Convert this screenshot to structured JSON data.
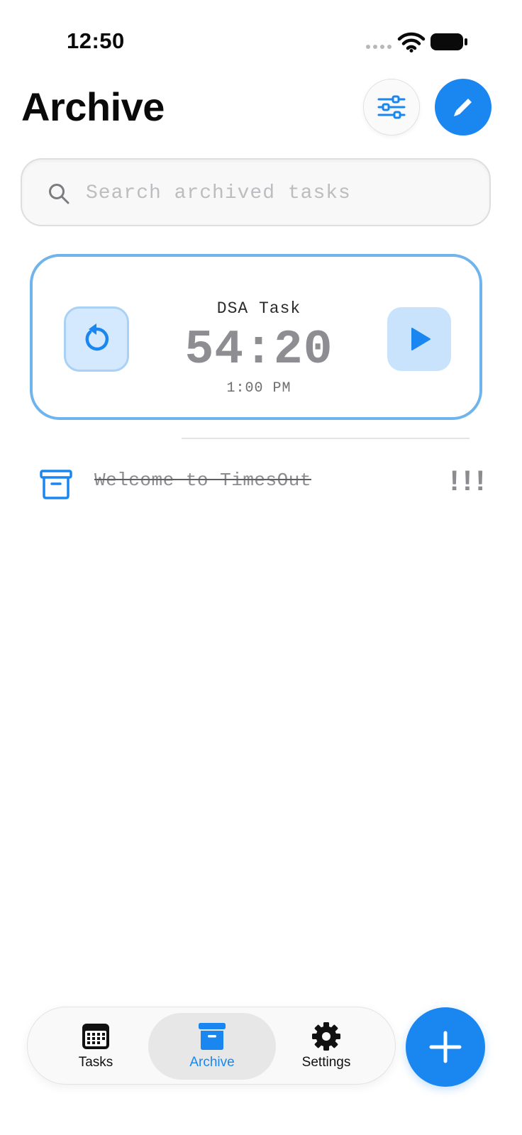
{
  "status_bar": {
    "time": "12:50",
    "icons": [
      "signal-dots-icon",
      "wifi-icon",
      "battery-icon"
    ]
  },
  "header": {
    "title": "Archive",
    "filter_icon": "sliders-icon",
    "edit_icon": "pencil-icon"
  },
  "search": {
    "placeholder": "Search archived tasks",
    "value": ""
  },
  "timer_card": {
    "task_name": "DSA Task",
    "countdown": "54:20",
    "scheduled_time": "1:00 PM",
    "reset_icon": "reset-icon",
    "play_icon": "play-icon"
  },
  "archived_tasks": [
    {
      "title": "Welcome to TimesOut",
      "priority": "!!!",
      "icon": "archive-box-icon",
      "completed": true
    }
  ],
  "tab_bar": {
    "tabs": [
      {
        "label": "Tasks",
        "icon": "calendar-icon",
        "active": false
      },
      {
        "label": "Archive",
        "icon": "archive-box-icon",
        "active": true
      },
      {
        "label": "Settings",
        "icon": "gear-icon",
        "active": false
      }
    ],
    "fab_icon": "plus-icon"
  },
  "colors": {
    "accent": "#1a87f0",
    "card_border": "#6fb4ec",
    "muted_text": "#8d8d92"
  }
}
